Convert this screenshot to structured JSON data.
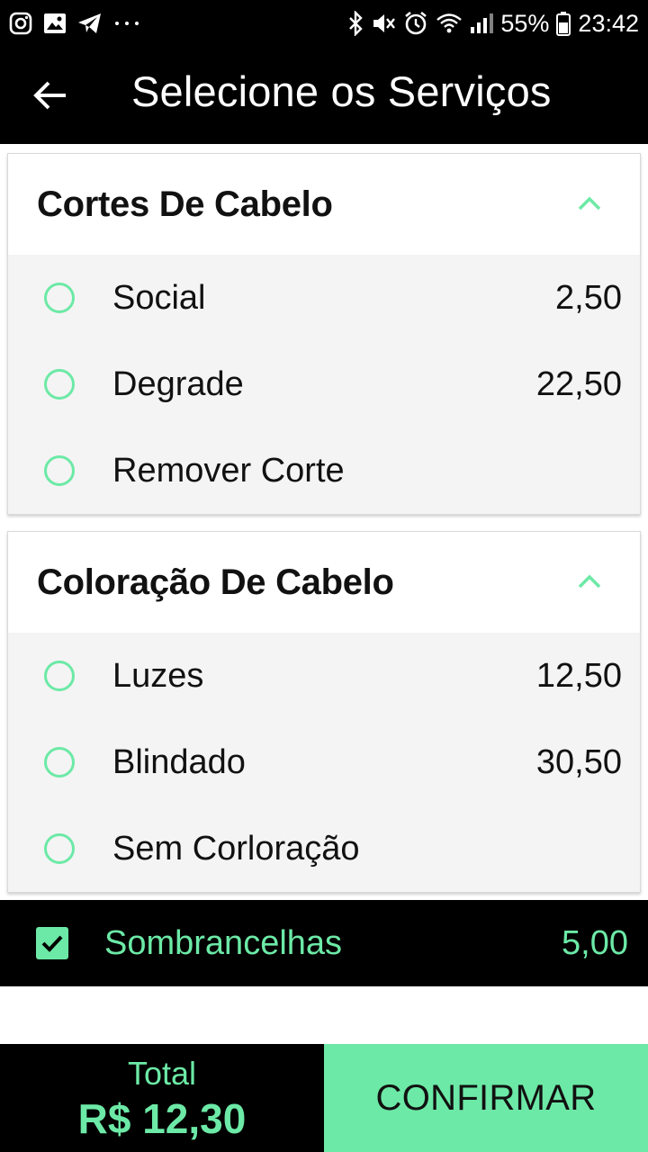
{
  "status_bar": {
    "battery_percent": "55%",
    "time": "23:42",
    "left_icons": [
      "instagram-icon",
      "gallery-icon",
      "telegram-icon",
      "more-icon"
    ],
    "right_icons": [
      "bluetooth-icon",
      "mute-icon",
      "alarm-icon",
      "wifi-icon",
      "signal-icon",
      "battery-icon"
    ]
  },
  "app_bar": {
    "title": "Selecione os Serviços",
    "back_icon": "arrow-left-icon"
  },
  "categories": [
    {
      "title": "Cortes De Cabelo",
      "expanded": true,
      "options": [
        {
          "label": "Social",
          "price": "2,50"
        },
        {
          "label": "Degrade",
          "price": "22,50"
        },
        {
          "label": "Remover Corte",
          "price": ""
        }
      ]
    },
    {
      "title": "Coloração De Cabelo",
      "expanded": true,
      "options": [
        {
          "label": "Luzes",
          "price": "12,50"
        },
        {
          "label": "Blindado",
          "price": "30,50"
        },
        {
          "label": "Sem Corloração",
          "price": ""
        }
      ]
    }
  ],
  "extra": {
    "label": "Sombrancelhas",
    "price": "5,00",
    "checked": true
  },
  "footer": {
    "total_label": "Total",
    "total_value": "R$ 12,30",
    "confirm_label": "CONFIRMAR"
  },
  "colors": {
    "accent": "#6ce9a6",
    "bar_background": "#000000",
    "list_background": "#f4f4f4"
  }
}
